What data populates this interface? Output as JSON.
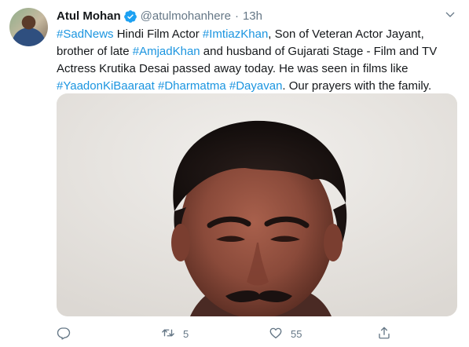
{
  "tweet": {
    "author_name": "Atul Mohan",
    "author_handle": "@atulmohanhere",
    "separator": "·",
    "time": "13h",
    "text_segments": [
      {
        "text": "#SadNews",
        "hashtag": true
      },
      {
        "text": " Hindi Film Actor ",
        "hashtag": false
      },
      {
        "text": "#ImtiazKhan",
        "hashtag": true
      },
      {
        "text": ", Son of Veteran Actor Jayant, brother of late ",
        "hashtag": false
      },
      {
        "text": "#AmjadKhan",
        "hashtag": true
      },
      {
        "text": " and husband of Gujarati Stage - Film and TV Actress Krutika Desai passed away today. He was seen in films like ",
        "hashtag": false
      },
      {
        "text": "#YaadonKiBaaraat",
        "hashtag": true
      },
      {
        "text": " ",
        "hashtag": false
      },
      {
        "text": "#Dharmatma",
        "hashtag": true
      },
      {
        "text": " ",
        "hashtag": false
      },
      {
        "text": "#Dayavan",
        "hashtag": true
      },
      {
        "text": ". Our prayers with the family.",
        "hashtag": false
      }
    ],
    "actions": {
      "reply_count": "",
      "retweet_count": "5",
      "like_count": "55"
    }
  },
  "icons": {
    "verified": "verified-badge-icon",
    "caret": "chevron-down-icon",
    "reply": "reply-icon",
    "retweet": "retweet-icon",
    "like": "heart-icon",
    "share": "share-icon"
  },
  "colors": {
    "link": "#1b95e0",
    "verified": "#1da1f2",
    "secondary_text": "#657786",
    "primary_text": "#14171a"
  }
}
